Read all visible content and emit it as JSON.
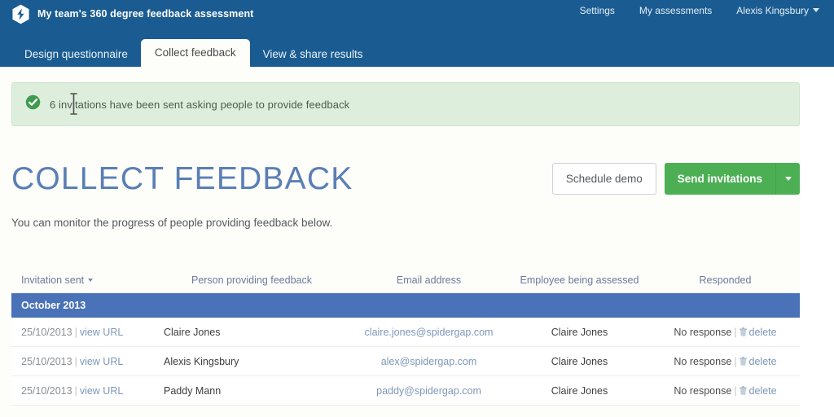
{
  "header": {
    "logo_icon": "spidergap-hexagon-logo",
    "title": "My team's 360 degree feedback assessment",
    "nav": [
      {
        "label": "Settings"
      },
      {
        "label": "My assessments"
      },
      {
        "label": "Alexis Kingsbury"
      }
    ],
    "user_menu_caret": "chevron-down-icon",
    "brand_blue": "#1a5c92"
  },
  "tabs": [
    {
      "label": "Design questionnaire",
      "active": false
    },
    {
      "label": "Collect feedback",
      "active": true
    },
    {
      "label": "View & share results",
      "active": false
    }
  ],
  "banner": {
    "icon": "check-circle-icon",
    "message": "6 invitations have been sent asking people to provide feedback",
    "background": "#ddeedd",
    "icon_color": "#3f9b4f"
  },
  "page": {
    "title": "COLLECT FEEDBACK",
    "subtitle": "You can monitor the progress of people providing feedback below.",
    "title_color": "#5a7fb5"
  },
  "actions": {
    "schedule_demo": "Schedule demo",
    "send_invitations": "Send invitations",
    "send_invitations_caret": "chevron-down-icon",
    "primary_color": "#4caf54"
  },
  "table": {
    "columns": [
      {
        "label": "Invitation sent",
        "sortable": true,
        "sort_icon": "caret-down-icon"
      },
      {
        "label": "Person providing feedback",
        "sortable": false
      },
      {
        "label": "Email address",
        "sortable": false
      },
      {
        "label": "Employee being assessed",
        "sortable": false
      },
      {
        "label": "Responded",
        "sortable": false
      }
    ],
    "groups": [
      {
        "group_label": "October 2013",
        "group_color": "#4a72b8",
        "rows": [
          {
            "invitation_sent": "25/10/2013",
            "separator": "|",
            "view_url_label": "view URL",
            "person": "Claire Jones",
            "email": "claire.jones@spidergap.com",
            "employee": "Claire Jones",
            "responded": "No response",
            "delete_label": "delete",
            "delete_icon": "trash-icon"
          },
          {
            "invitation_sent": "25/10/2013",
            "separator": "|",
            "view_url_label": "view URL",
            "person": "Alexis Kingsbury",
            "email": "alex@spidergap.com",
            "employee": "Claire Jones",
            "responded": "No response",
            "delete_label": "delete",
            "delete_icon": "trash-icon"
          },
          {
            "invitation_sent": "25/10/2013",
            "separator": "|",
            "view_url_label": "view URL",
            "person": "Paddy Mann",
            "email": "paddy@spidergap.com",
            "employee": "Claire Jones",
            "responded": "No response",
            "delete_label": "delete",
            "delete_icon": "trash-icon"
          }
        ]
      }
    ]
  },
  "cursor": {
    "type": "text-ibeam-cursor"
  }
}
